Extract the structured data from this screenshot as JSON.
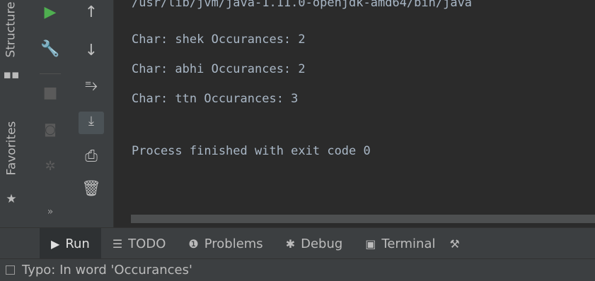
{
  "side_tabs": {
    "structure_label": "Structure",
    "favorites_label": "Favorites"
  },
  "console": {
    "lines": [
      "/usr/lib/jvm/java-1.11.0-openjdk-amd64/bin/java",
      "Char: shek Occurances: 2",
      "Char: abhi Occurances: 2",
      "Char: ttn Occurances: 3",
      "",
      "Process finished with exit code 0"
    ]
  },
  "bottom_tabs": [
    {
      "label": "Run",
      "icon": "play-icon",
      "active": true
    },
    {
      "label": "TODO",
      "icon": "list-icon",
      "active": false
    },
    {
      "label": "Problems",
      "icon": "info-circle-icon",
      "active": false
    },
    {
      "label": "Debug",
      "icon": "bug-icon",
      "active": false
    },
    {
      "label": "Terminal",
      "icon": "terminal-icon",
      "active": false
    }
  ],
  "status_bar": {
    "message": "Typo: In word 'Occurances'"
  },
  "colors": {
    "accent_green": "#4faf50",
    "panel_bg": "#3c3f41",
    "editor_bg": "#2b2b2b"
  }
}
